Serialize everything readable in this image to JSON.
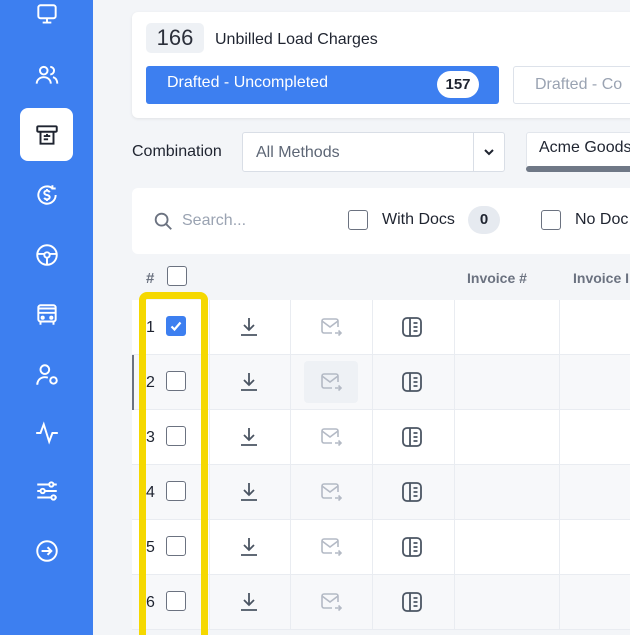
{
  "sidebar": {
    "items": [
      {
        "icon": "monitor-icon",
        "active": false
      },
      {
        "icon": "users-icon",
        "active": false
      },
      {
        "icon": "billing-icon",
        "active": true
      },
      {
        "icon": "dollar-refresh-icon",
        "active": false
      },
      {
        "icon": "steering-wheel-icon",
        "active": false
      },
      {
        "icon": "bus-icon",
        "active": false
      },
      {
        "icon": "user-settings-icon",
        "active": false
      },
      {
        "icon": "activity-icon",
        "active": false
      },
      {
        "icon": "sliders-icon",
        "active": false
      },
      {
        "icon": "logout-icon",
        "active": false
      }
    ]
  },
  "summary": {
    "count": "166",
    "title": "Unbilled Load Charges",
    "active_tab": {
      "label": "Drafted - Uncompleted",
      "count": "157"
    },
    "inactive_tab": {
      "label": "Drafted - Co"
    }
  },
  "filters": {
    "combination_label": "Combination",
    "combination_value": "All Methods",
    "customer_chip": "Acme Goods"
  },
  "search": {
    "placeholder": "Search...",
    "with_docs_label": "With Docs",
    "with_docs_count": "0",
    "no_docs_label": "No Doc"
  },
  "table": {
    "headers": {
      "num": "#",
      "invoice_num": "Invoice #",
      "invoice_partial": "Invoice I"
    },
    "rows": [
      {
        "num": "1",
        "checked": true
      },
      {
        "num": "2",
        "checked": false
      },
      {
        "num": "3",
        "checked": false
      },
      {
        "num": "4",
        "checked": false
      },
      {
        "num": "5",
        "checked": false
      },
      {
        "num": "6",
        "checked": false
      }
    ]
  },
  "colors": {
    "brand_blue": "#3d7ff0",
    "highlight_yellow": "#f5d800"
  }
}
